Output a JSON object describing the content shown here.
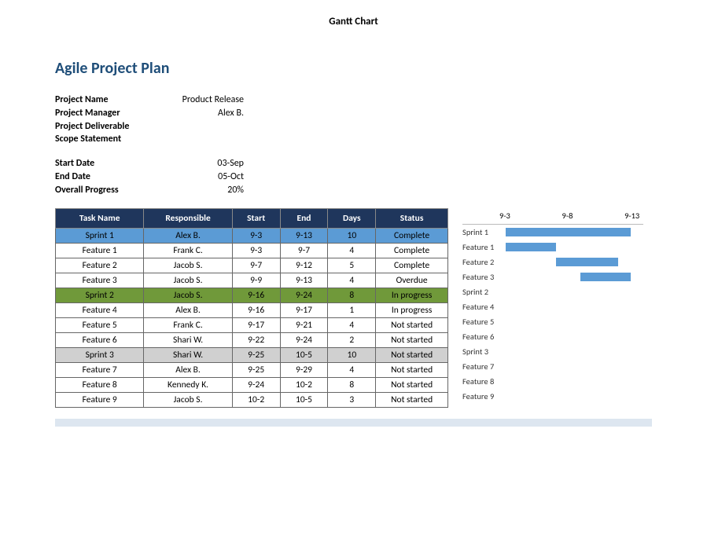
{
  "doc_title": "Gantt Chart",
  "project_title": "Agile Project Plan",
  "info1": [
    {
      "label": "Project Name",
      "value": "Product Release"
    },
    {
      "label": "Project Manager",
      "value": "Alex B."
    },
    {
      "label": "Project Deliverable",
      "value": ""
    },
    {
      "label": "Scope Statement",
      "value": ""
    }
  ],
  "info2": [
    {
      "label": "Start Date",
      "value": "03-Sep"
    },
    {
      "label": "End Date",
      "value": "05-Oct"
    },
    {
      "label": "Overall Progress",
      "value": "20%"
    }
  ],
  "columns": [
    "Task Name",
    "Responsible",
    "Start",
    "End",
    "Days",
    "Status"
  ],
  "rows": [
    {
      "cls": "sprint-blue",
      "task": "Sprint 1",
      "resp": "Alex B.",
      "start": "9-3",
      "end": "9-13",
      "days": "10",
      "status": "Complete"
    },
    {
      "cls": "",
      "task": "Feature 1",
      "resp": "Frank C.",
      "start": "9-3",
      "end": "9-7",
      "days": "4",
      "status": "Complete"
    },
    {
      "cls": "",
      "task": "Feature 2",
      "resp": "Jacob S.",
      "start": "9-7",
      "end": "9-12",
      "days": "5",
      "status": "Complete"
    },
    {
      "cls": "",
      "task": "Feature 3",
      "resp": "Jacob S.",
      "start": "9-9",
      "end": "9-13",
      "days": "4",
      "status": "Overdue"
    },
    {
      "cls": "sprint-green",
      "task": "Sprint 2",
      "resp": "Jacob S.",
      "start": "9-16",
      "end": "9-24",
      "days": "8",
      "status": "In progress"
    },
    {
      "cls": "",
      "task": "Feature 4",
      "resp": "Alex B.",
      "start": "9-16",
      "end": "9-17",
      "days": "1",
      "status": "In progress"
    },
    {
      "cls": "",
      "task": "Feature 5",
      "resp": "Frank C.",
      "start": "9-17",
      "end": "9-21",
      "days": "4",
      "status": "Not started"
    },
    {
      "cls": "",
      "task": "Feature 6",
      "resp": "Shari W.",
      "start": "9-22",
      "end": "9-24",
      "days": "2",
      "status": "Not started"
    },
    {
      "cls": "sprint-grey",
      "task": "Sprint 3",
      "resp": "Shari W.",
      "start": "9-25",
      "end": "10-5",
      "days": "10",
      "status": "Not started"
    },
    {
      "cls": "",
      "task": "Feature 7",
      "resp": "Alex B.",
      "start": "9-25",
      "end": "9-29",
      "days": "4",
      "status": "Not started"
    },
    {
      "cls": "",
      "task": "Feature 8",
      "resp": "Kennedy K.",
      "start": "9-24",
      "end": "10-2",
      "days": "8",
      "status": "Not started"
    },
    {
      "cls": "",
      "task": "Feature 9",
      "resp": "Jacob S.",
      "start": "10-2",
      "end": "10-5",
      "days": "3",
      "status": "Not started"
    }
  ],
  "chart_data": {
    "type": "bar",
    "title": "",
    "xlabel": "",
    "ylabel": "",
    "x_ticks": [
      "9-3",
      "9-8",
      "9-13"
    ],
    "x_range": [
      3,
      14
    ],
    "series": [
      {
        "name": "Sprint 1",
        "start": 3,
        "end": 13
      },
      {
        "name": "Feature 1",
        "start": 3,
        "end": 7
      },
      {
        "name": "Feature 2",
        "start": 7,
        "end": 12
      },
      {
        "name": "Feature 3",
        "start": 9,
        "end": 13
      },
      {
        "name": "Sprint 2",
        "start": null,
        "end": null
      },
      {
        "name": "Feature 4",
        "start": null,
        "end": null
      },
      {
        "name": "Feature 5",
        "start": null,
        "end": null
      },
      {
        "name": "Feature 6",
        "start": null,
        "end": null
      },
      {
        "name": "Sprint 3",
        "start": null,
        "end": null
      },
      {
        "name": "Feature 7",
        "start": null,
        "end": null
      },
      {
        "name": "Feature 8",
        "start": null,
        "end": null
      },
      {
        "name": "Feature 9",
        "start": null,
        "end": null
      }
    ]
  }
}
